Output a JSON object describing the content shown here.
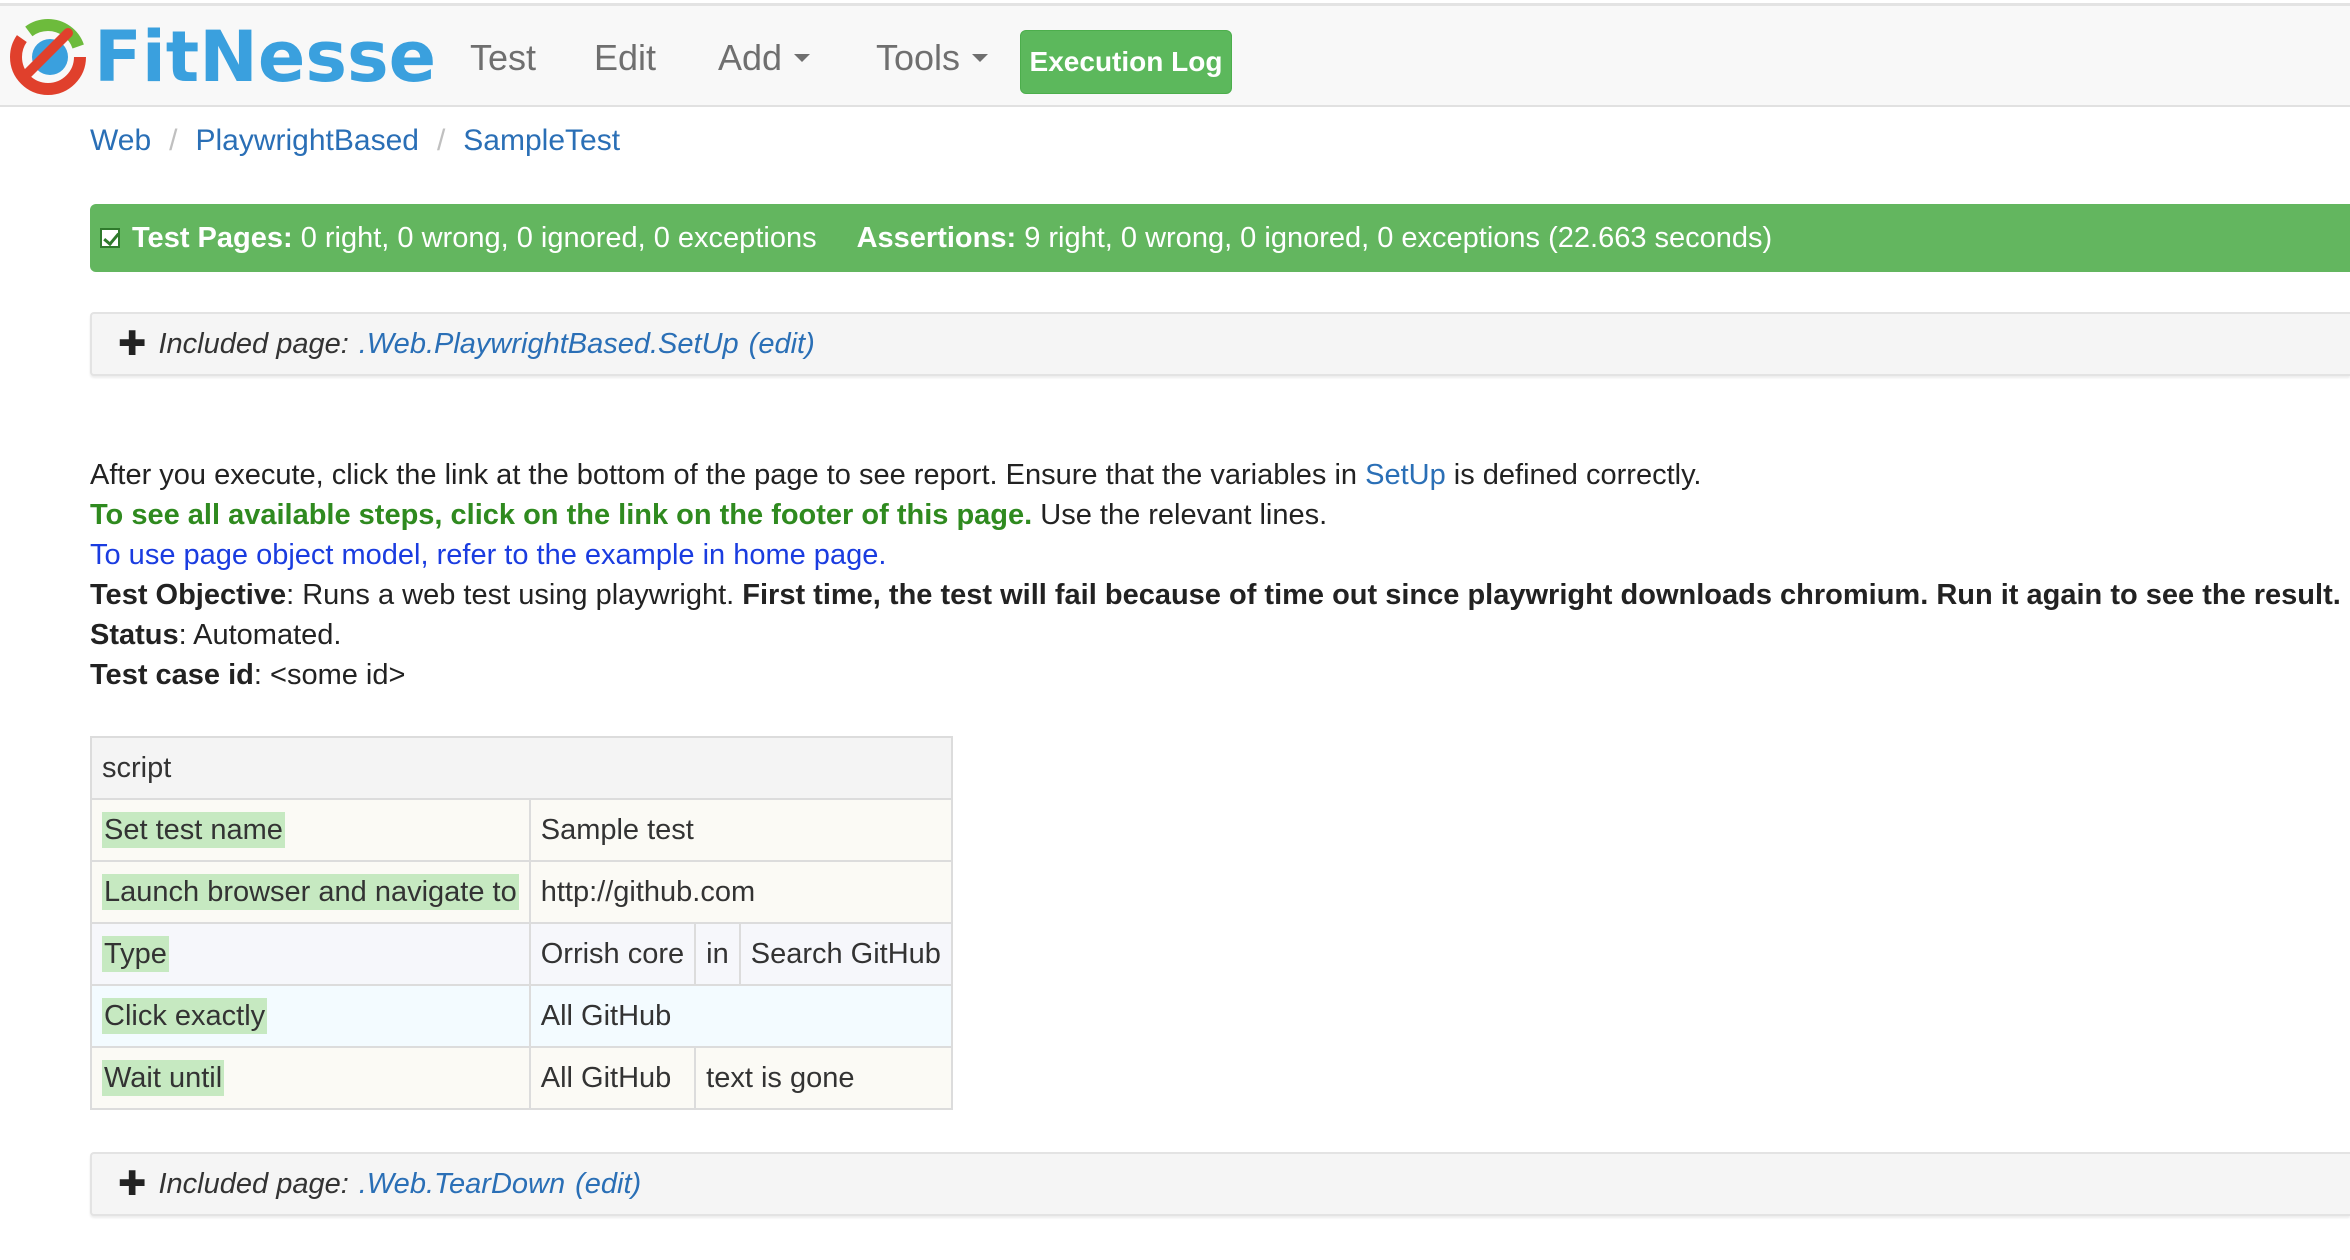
{
  "header": {
    "logo_text": "FitNesse",
    "nav": {
      "test": "Test",
      "edit": "Edit",
      "add": "Add",
      "tools": "Tools"
    },
    "execution_log": "Execution Log"
  },
  "breadcrumb": {
    "items": [
      "Web",
      "PlaywrightBased",
      "SampleTest"
    ],
    "separator": "/"
  },
  "summary": {
    "test_pages_label": "Test Pages:",
    "test_pages_value": "0 right, 0 wrong, 0 ignored, 0 exceptions",
    "assertions_label": "Assertions:",
    "assertions_value": "9 right, 0 wrong, 0 ignored, 0 exceptions (22.663 seconds)"
  },
  "include_setup": {
    "label": "Included page:",
    "page": ".Web.PlaywrightBased.SetUp",
    "edit": "(edit)"
  },
  "include_teardown": {
    "label": "Included page:",
    "page": ".Web.TearDown",
    "edit": "(edit)"
  },
  "content": {
    "line1_pre": "After you execute, click the link at the bottom of the page to see report. Ensure that the variables in",
    "line1_link": "SetUp",
    "line1_post": "is defined correctly.",
    "line2_green": "To see all available steps, click on the link on the footer of this page.",
    "line2_post": "Use the relevant lines.",
    "line3_link": "To use page object model, refer to the example in home page.",
    "objective_label": "Test Objective",
    "objective_text": ": Runs a web test using playwright.",
    "objective_bold": "First time, the test will fail because of time out since playwright downloads chromium. Run it again to see the result.",
    "status_label": "Status",
    "status_text": ": Automated.",
    "caseid_label": "Test case id",
    "caseid_text": ": <some id>"
  },
  "script_table": {
    "header": "script",
    "rows": [
      {
        "action": "Set test name",
        "arg1": "Sample test"
      },
      {
        "action": "Launch browser and navigate to",
        "arg1": "http://github.com"
      },
      {
        "action": "Type",
        "arg1": "Orrish core",
        "arg2": "in",
        "arg3": "Search GitHub"
      },
      {
        "action": "Click exactly",
        "arg1": "All GitHub"
      },
      {
        "action": "Wait until",
        "arg1": "All GitHub",
        "arg2": "text is gone"
      }
    ]
  },
  "colors": {
    "success": "#5cb85c",
    "pass_cell": "#c6e9c1",
    "link": "#2a6fb6"
  }
}
